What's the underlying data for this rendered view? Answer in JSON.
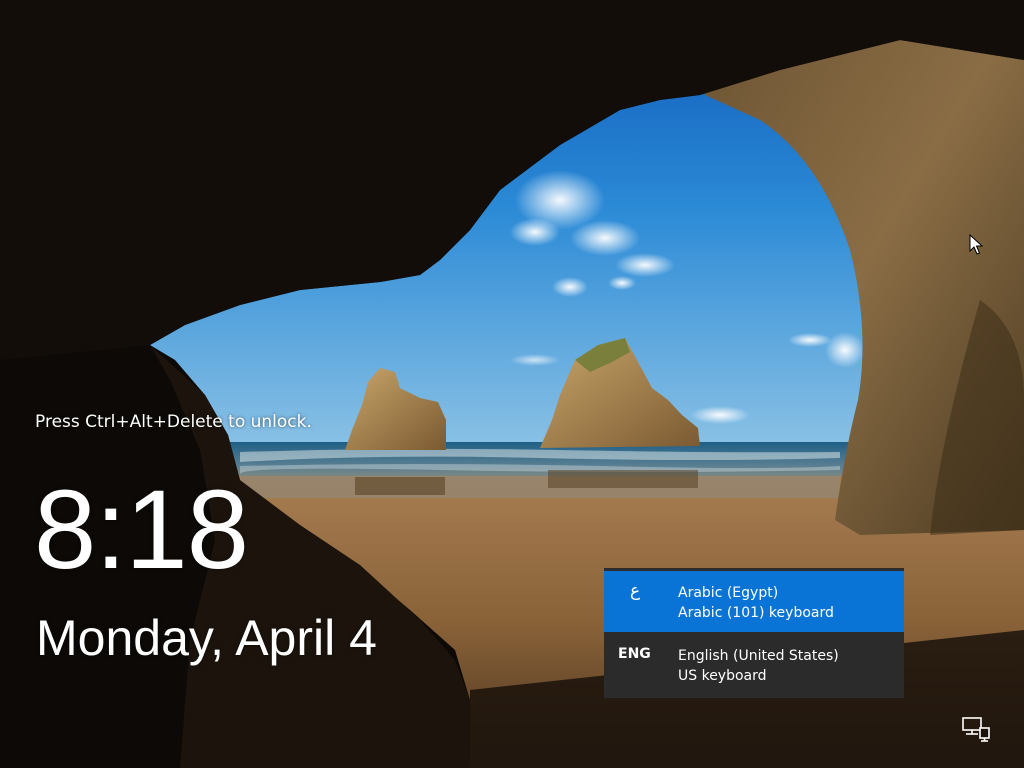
{
  "lock_screen": {
    "unlock_hint": "Press Ctrl+Alt+Delete to unlock.",
    "time": "8:18",
    "date": "Monday, April 4"
  },
  "language_flyout": {
    "items": [
      {
        "code": "ع",
        "language": "Arabic (Egypt)",
        "keyboard": "Arabic (101) keyboard",
        "selected": true
      },
      {
        "code": "ENG",
        "language": "English (United States)",
        "keyboard": "US keyboard",
        "selected": false
      }
    ],
    "selected_color": "#0a74d6",
    "background_color": "#2b2b2b"
  },
  "system_tray": {
    "network_icon": "network-wired-icon"
  },
  "cursor": {
    "icon": "mouse-pointer-icon"
  }
}
